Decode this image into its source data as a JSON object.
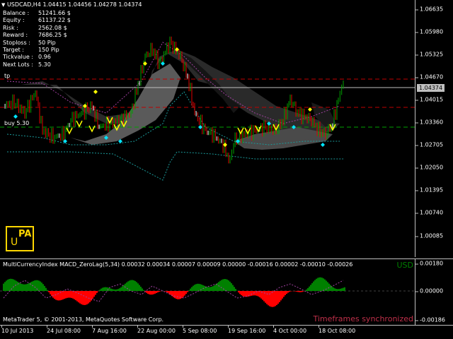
{
  "symbol": {
    "name": "USDCAD,H4",
    "open": "1.04415",
    "high": "1.04456",
    "low": "1.04278",
    "close": "1.04374"
  },
  "info_panel": [
    {
      "label": "Balance :",
      "value": "51241.66 $"
    },
    {
      "label": "Equity :",
      "value": "61137.22 $"
    },
    {
      "label": "Risk :",
      "value": "2562.08 $"
    },
    {
      "label": "Reward :",
      "value": "7686.25 $"
    },
    {
      "label": "Stoploss :",
      "value": "50 Pip"
    },
    {
      "label": "Target :",
      "value": "150 Pip"
    },
    {
      "label": "Tickvalue :",
      "value": "0.96"
    },
    {
      "label": "Next Lots :",
      "value": "5.30"
    }
  ],
  "labels": {
    "tp": "tp",
    "buy": "buy 5.30"
  },
  "current_price": "1.04374",
  "price_axis": [
    "1.06635",
    "1.05980",
    "1.05325",
    "1.04670",
    "1.04015",
    "1.03360",
    "1.02705",
    "1.02050",
    "1.01395",
    "1.00740",
    "1.00085"
  ],
  "time_axis": [
    "10 Jul 2013",
    "24 Jul 08:00",
    "7 Aug 16:00",
    "22 Aug 00:00",
    "5 Sep 08:00",
    "19 Sep 16:00",
    "4 Oct 00:00",
    "18 Oct 08:00"
  ],
  "logo": {
    "top": "PA",
    "bottom": "U"
  },
  "subwindow": {
    "title": "MultiCurrencyIndex MACD_ZeroLag(5,34) 0.00032 0.00034 0.00007 0.00009 0.00000 -0.00016 0.00002 -0.00010 -0.00026",
    "currency": "USD",
    "copyright": "MetaTrader 5, © 2001-2013, MetaQuotes Software Corp.",
    "sync": "Timeframes synchronized",
    "axis": [
      "0.00180",
      "0.00000",
      "-0.00186"
    ]
  },
  "colors": {
    "background": "#000000",
    "bull": "#00a000",
    "bear": "#e00000",
    "neutral": "#ffffff",
    "tp_line": "#c00000",
    "buy_line": "#00a000",
    "current_line": "#c0c0c0",
    "macd_pos": "#008000",
    "macd_neg": "#ff0000",
    "sync_text": "#c0304a",
    "logo": "#ffd700"
  }
}
